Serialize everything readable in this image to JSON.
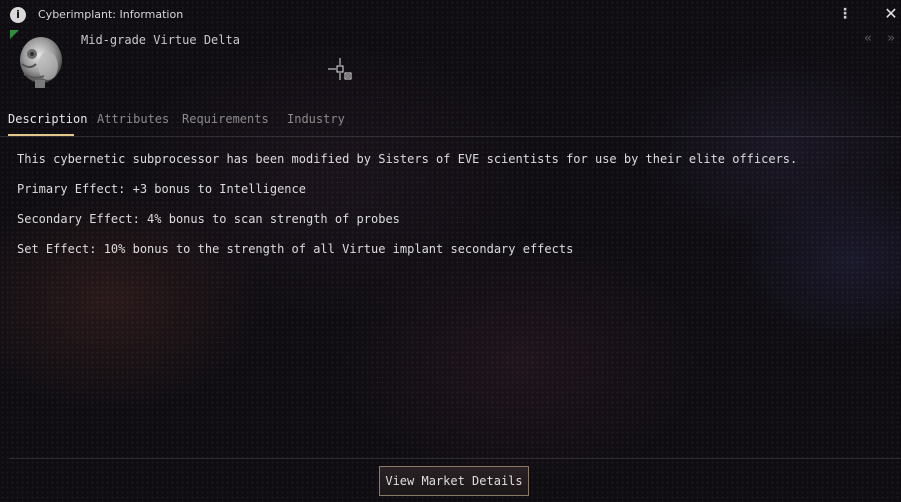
{
  "window": {
    "title": "Cyberimplant: Information",
    "info_icon": "info-icon",
    "menu_icon": "kebab-menu-icon",
    "close_icon": "close-icon"
  },
  "item": {
    "name": "Mid-grade Virtue Delta",
    "icon": "cyberimplant-icon"
  },
  "navigation": {
    "back_icon": "double-chevron-left-icon",
    "forward_icon": "double-chevron-right-icon"
  },
  "tabs": [
    {
      "label": "Description",
      "active": true
    },
    {
      "label": "Attributes",
      "active": false
    },
    {
      "label": "Requirements",
      "active": false
    },
    {
      "label": "Industry",
      "active": false
    }
  ],
  "description": {
    "paragraphs": [
      "This cybernetic subprocessor has been modified by Sisters of EVE scientists for use by their elite officers.",
      "Primary Effect: +3 bonus to Intelligence",
      "Secondary Effect: 4% bonus to scan strength of probes",
      "Set Effect: 10% bonus to the strength of all Virtue implant secondary effects"
    ]
  },
  "footer": {
    "market_button_label": "View Market Details"
  },
  "colors": {
    "active_tab_underline": "#e1c88a",
    "button_border": "#8b7a63",
    "background": "#0f0d12"
  }
}
